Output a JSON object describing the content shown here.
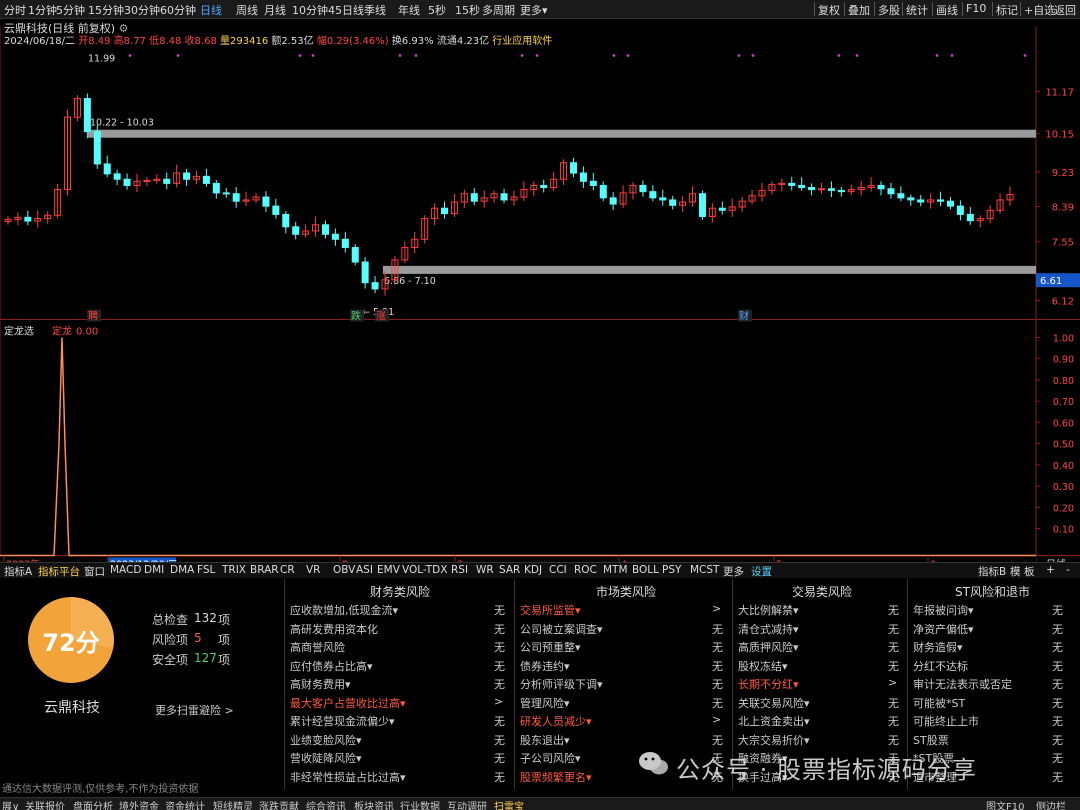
{
  "toolbar": {
    "periods": [
      "分时",
      "1分钟",
      "5分钟",
      "15分钟",
      "30分钟",
      "60分钟",
      "日线",
      "周线",
      "月线",
      "10分钟",
      "45日线",
      "季线",
      "年线",
      "5秒",
      "15秒",
      "多周期",
      "更多▾"
    ],
    "active_period": "日线",
    "right_tools": [
      "复权",
      "叠加",
      "多股",
      "统计",
      "画线",
      "F10",
      "标记",
      "+自选",
      "返回"
    ]
  },
  "caption": {
    "title": "云鼎科技(日线 前复权)",
    "date": "2024/06/18/二",
    "open": "开8.49",
    "high": "高8.77",
    "low": "低8.48",
    "close": "收8.68",
    "volume": "量293416",
    "amount": "额2.53亿",
    "change": "幅0.29(3.46%)",
    "turnover": "换6.93%",
    "float": "流通4.23亿",
    "industry": "行业应用软件"
  },
  "chart_data": {
    "type": "candlestick",
    "y_ticks": [
      "11.17",
      "10.15",
      "9.23",
      "8.39",
      "7.55",
      "6.12"
    ],
    "current_price_label": "6.61",
    "resistance_label": "10.22 - 10.03",
    "support_label": "6.86 - 7.10",
    "high_label": "11.99",
    "low_label": "← 5.91",
    "markers": [
      "聘",
      "跌",
      "涨",
      "财"
    ],
    "indicator_title": "定龙选",
    "indicator_name": "定龙",
    "indicator_value": "0.00",
    "indicator_y_ticks": [
      "1.00",
      "0.90",
      "0.80",
      "0.70",
      "0.60",
      "0.50",
      "0.40",
      "0.30",
      "0.20",
      "0.10"
    ],
    "x_labels": [
      "2023年",
      "2023/12/20/三",
      "2",
      "3",
      "4",
      "5",
      "6"
    ],
    "x_right": "日线",
    "colors": {
      "up": "#ff3c3c",
      "down": "#54ffff",
      "band": "#9a9a9a",
      "indicator": "#ff8c5a"
    }
  },
  "indicator_tabs": [
    "指标A",
    "指标平台",
    "窗口",
    "MACD",
    "DMI",
    "DMA",
    "FSL",
    "TRIX",
    "BRAR",
    "CR",
    "VR",
    "OBV",
    "ASI",
    "EMV",
    "VOL-TDX",
    "RSI",
    "WR",
    "SAR",
    "KDJ",
    "CCI",
    "ROC",
    "MTM",
    "BOLL",
    "PSY",
    "MCST",
    "更多",
    "设置"
  ],
  "indicator_tabs_right": [
    "指标B",
    "模",
    "板",
    "+",
    "-"
  ],
  "risk_panel": {
    "score": "72分",
    "company": "云鼎科技",
    "total_label": "总检查",
    "total_value": "132",
    "total_unit": "项",
    "risk_label": "风险项",
    "risk_value": "5",
    "risk_unit": "项",
    "safe_label": "安全项",
    "safe_value": "127",
    "safe_unit": "项",
    "more": "更多扫雷避险 >",
    "columns": [
      {
        "title": "财务类风险",
        "items": [
          {
            "label": "应收款增加,低现金流▾",
            "result": "无"
          },
          {
            "label": "高研发费用资本化",
            "result": "无"
          },
          {
            "label": "高商誉风险",
            "result": "无"
          },
          {
            "label": "应付债券占比高▾",
            "result": "无"
          },
          {
            "label": "高财务费用▾",
            "result": "无"
          },
          {
            "label": "最大客户占营收比过高▾",
            "result": ">",
            "warn": true
          },
          {
            "label": "累计经营现金流偏少▾",
            "result": "无"
          },
          {
            "label": "业绩变脸风险▾",
            "result": "无"
          },
          {
            "label": "营收陡降风险▾",
            "result": "无"
          },
          {
            "label": "非经常性损益占比过高▾",
            "result": "无"
          }
        ]
      },
      {
        "title": "市场类风险",
        "items": [
          {
            "label": "交易所监管▾",
            "result": ">",
            "warn": true
          },
          {
            "label": "公司被立案调查▾",
            "result": "无"
          },
          {
            "label": "公司预重整▾",
            "result": "无"
          },
          {
            "label": "债券违约▾",
            "result": "无"
          },
          {
            "label": "分析师评级下调▾",
            "result": "无"
          },
          {
            "label": "管理风险▾",
            "result": "无"
          },
          {
            "label": "研发人员减少▾",
            "result": ">",
            "warn": true
          },
          {
            "label": "股东退出▾",
            "result": "无"
          },
          {
            "label": "子公司风险▾",
            "result": "无"
          },
          {
            "label": "股票频繁更名▾",
            "result": "无",
            "warn": true
          }
        ]
      },
      {
        "title": "交易类风险",
        "items": [
          {
            "label": "大比例解禁▾",
            "result": "无"
          },
          {
            "label": "清仓式减持▾",
            "result": "无"
          },
          {
            "label": "高质押风险▾",
            "result": "无"
          },
          {
            "label": "股权冻结▾",
            "result": "无"
          },
          {
            "label": "长期不分红▾",
            "result": ">",
            "warn": true
          },
          {
            "label": "关联交易风险▾",
            "result": "无"
          },
          {
            "label": "北上资金卖出▾",
            "result": "无"
          },
          {
            "label": "大宗交易折价▾",
            "result": "无"
          },
          {
            "label": "融资融券▾",
            "result": "无"
          },
          {
            "label": "换手过高▾",
            "result": "无"
          }
        ]
      },
      {
        "title": "ST风险和退市",
        "items": [
          {
            "label": "年报被问询▾",
            "result": "无"
          },
          {
            "label": "净资产偏低▾",
            "result": "无"
          },
          {
            "label": "财务造假▾",
            "result": "无"
          },
          {
            "label": "分红不达标",
            "result": "无"
          },
          {
            "label": "审计无法表示或否定",
            "result": "无"
          },
          {
            "label": "可能被*ST",
            "result": "无"
          },
          {
            "label": "可能终止上市",
            "result": "无"
          },
          {
            "label": "ST股票",
            "result": "无"
          },
          {
            "label": "*ST股票",
            "result": "无"
          },
          {
            "label": "退市整理",
            "result": "无"
          }
        ]
      }
    ]
  },
  "status_text": "通达信大数据评测,仅供参考,不作为投资依据",
  "bottom_tabs": [
    "展∨",
    "关联报价",
    "盘面分析",
    "境外资金",
    "资金统计",
    "短线精灵",
    "涨跌贡献",
    "综合资讯",
    "板块资讯",
    "行业数据",
    "互动调研",
    "扫雷宝"
  ],
  "bottom_active": "扫雷宝",
  "bottom_right": [
    "图文F10",
    "侧边栏"
  ],
  "watermark": "公众号 · 股票指标源码分享"
}
